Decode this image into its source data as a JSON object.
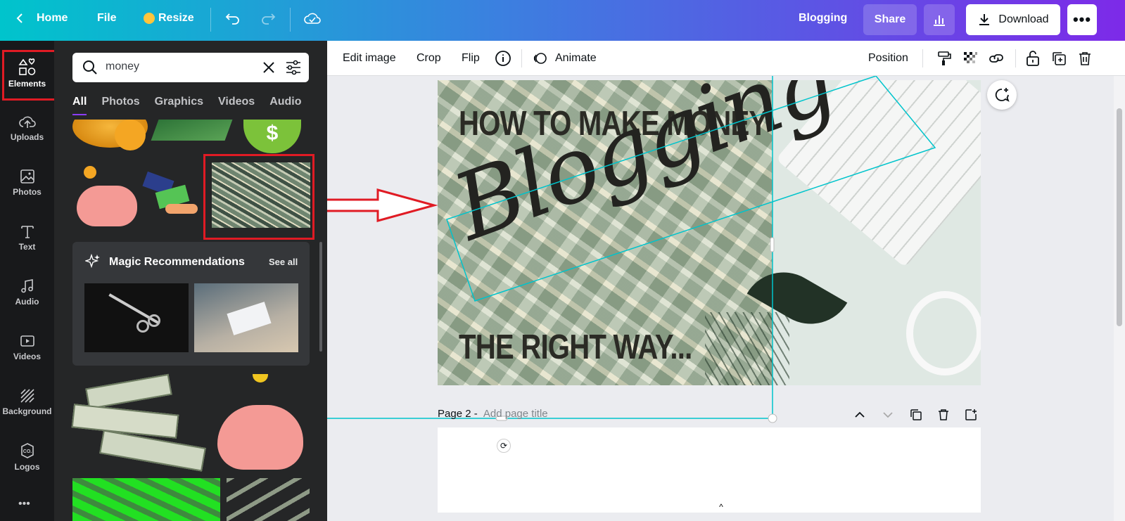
{
  "topbar": {
    "home": "Home",
    "file": "File",
    "resize": "Resize",
    "design_title": "Blogging",
    "share": "Share",
    "download": "Download"
  },
  "rail": {
    "items": [
      {
        "label": "Elements",
        "icon": "elements-icon"
      },
      {
        "label": "Uploads",
        "icon": "upload-cloud-icon"
      },
      {
        "label": "Photos",
        "icon": "image-icon"
      },
      {
        "label": "Text",
        "icon": "text-icon"
      },
      {
        "label": "Audio",
        "icon": "music-note-icon"
      },
      {
        "label": "Videos",
        "icon": "video-icon"
      },
      {
        "label": "Background",
        "icon": "pattern-icon"
      },
      {
        "label": "Logos",
        "icon": "logo-badge-icon"
      }
    ]
  },
  "panel": {
    "search_value": "money",
    "tabs": [
      "All",
      "Photos",
      "Graphics",
      "Videos",
      "Audio"
    ],
    "magic_title": "Magic Recommendations",
    "see_all": "See all"
  },
  "toolbar": {
    "edit_image": "Edit image",
    "crop": "Crop",
    "flip": "Flip",
    "animate": "Animate",
    "position": "Position"
  },
  "canvas": {
    "headline_top": "HOW TO MAKE MONEY",
    "script_word": "Blogging",
    "headline_bottom": "THE RIGHT WAY...",
    "page2_label": "Page 2 -",
    "page2_placeholder": "Add page title"
  },
  "colors": {
    "accent": "#8b3dff",
    "highlight_box": "#e01b24",
    "selection": "#00c4cc",
    "gradient_start": "#00c4cc",
    "gradient_end": "#7d2ae8"
  }
}
